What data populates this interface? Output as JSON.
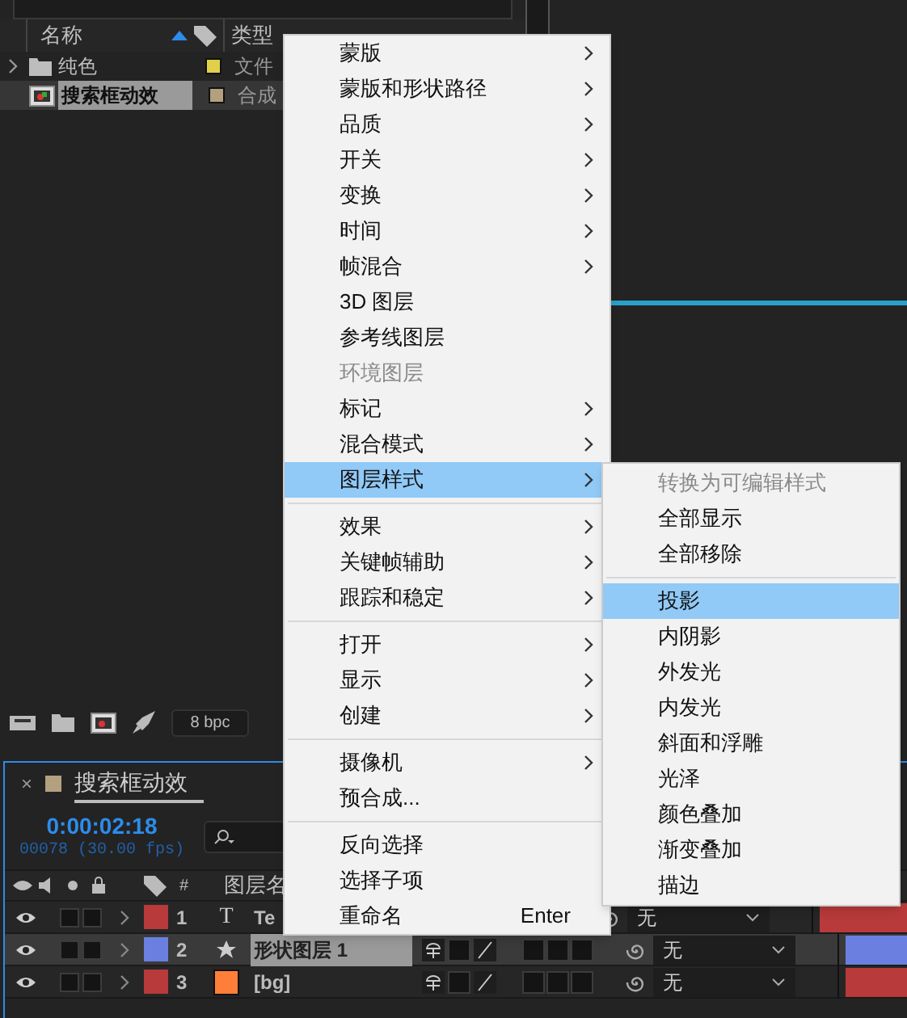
{
  "project": {
    "columns": [
      {
        "label": "名称",
        "sorted": true
      },
      {
        "label": "类型",
        "sorted": false
      }
    ],
    "items": [
      {
        "kind": "folder",
        "name": "纯色",
        "color": "#e0d04a",
        "type": "文件",
        "selected": false
      },
      {
        "kind": "comp",
        "name": "搜索框动效",
        "color": "#b3a07e",
        "type": "合成",
        "selected": true
      }
    ],
    "toolbar": {
      "bpc": "8 bpc"
    }
  },
  "timeline": {
    "close": "×",
    "tab": "搜索框动效",
    "time": "0:00:02:18",
    "frames": "00078 (30.00 fps)",
    "columns": [
      "#",
      "图层名"
    ],
    "layers": [
      {
        "number": "1",
        "kind": "text",
        "type_glyph": "T",
        "name": "Te",
        "color": "#b83a3a",
        "selected": false,
        "mode": "无"
      },
      {
        "number": "2",
        "kind": "shape",
        "name": "形状图层 1",
        "color": "#6b7fe0",
        "selected": true,
        "mode": "无"
      },
      {
        "number": "3",
        "kind": "solid",
        "name": "[bg]",
        "color": "#b83a3a",
        "selected": false,
        "mode": "无"
      }
    ]
  },
  "context_menu": {
    "items": [
      {
        "kind": "item",
        "label": "蒙版",
        "submenu": true,
        "disabled": false,
        "selected": false
      },
      {
        "kind": "item",
        "label": "蒙版和形状路径",
        "submenu": true,
        "disabled": false,
        "selected": false
      },
      {
        "kind": "item",
        "label": "品质",
        "submenu": true,
        "disabled": false,
        "selected": false
      },
      {
        "kind": "item",
        "label": "开关",
        "submenu": true,
        "disabled": false,
        "selected": false
      },
      {
        "kind": "item",
        "label": "变换",
        "submenu": true,
        "disabled": false,
        "selected": false
      },
      {
        "kind": "item",
        "label": "时间",
        "submenu": true,
        "disabled": false,
        "selected": false
      },
      {
        "kind": "item",
        "label": "帧混合",
        "submenu": true,
        "disabled": false,
        "selected": false
      },
      {
        "kind": "item",
        "label": "3D 图层",
        "submenu": false,
        "disabled": false,
        "selected": false
      },
      {
        "kind": "item",
        "label": "参考线图层",
        "submenu": false,
        "disabled": false,
        "selected": false
      },
      {
        "kind": "item",
        "label": "环境图层",
        "submenu": false,
        "disabled": true,
        "selected": false
      },
      {
        "kind": "item",
        "label": "标记",
        "submenu": true,
        "disabled": false,
        "selected": false
      },
      {
        "kind": "item",
        "label": "混合模式",
        "submenu": true,
        "disabled": false,
        "selected": false
      },
      {
        "kind": "item",
        "label": "图层样式",
        "submenu": true,
        "disabled": false,
        "selected": true
      },
      {
        "kind": "separator"
      },
      {
        "kind": "item",
        "label": "效果",
        "submenu": true,
        "disabled": false,
        "selected": false
      },
      {
        "kind": "item",
        "label": "关键帧辅助",
        "submenu": true,
        "disabled": false,
        "selected": false
      },
      {
        "kind": "item",
        "label": "跟踪和稳定",
        "submenu": true,
        "disabled": false,
        "selected": false
      },
      {
        "kind": "separator"
      },
      {
        "kind": "item",
        "label": "打开",
        "submenu": true,
        "disabled": false,
        "selected": false
      },
      {
        "kind": "item",
        "label": "显示",
        "submenu": true,
        "disabled": false,
        "selected": false
      },
      {
        "kind": "item",
        "label": "创建",
        "submenu": true,
        "disabled": false,
        "selected": false
      },
      {
        "kind": "separator"
      },
      {
        "kind": "item",
        "label": "摄像机",
        "submenu": true,
        "disabled": false,
        "selected": false
      },
      {
        "kind": "item",
        "label": "预合成...",
        "submenu": false,
        "disabled": false,
        "selected": false
      },
      {
        "kind": "separator"
      },
      {
        "kind": "item",
        "label": "反向选择",
        "submenu": false,
        "disabled": false,
        "selected": false
      },
      {
        "kind": "item",
        "label": "选择子项",
        "submenu": false,
        "disabled": false,
        "selected": false
      },
      {
        "kind": "item",
        "label": "重命名",
        "shortcut": "Enter",
        "submenu": false,
        "disabled": false,
        "selected": false
      }
    ]
  },
  "submenu": {
    "items": [
      {
        "kind": "item",
        "label": "转换为可编辑样式",
        "disabled": true,
        "selected": false
      },
      {
        "kind": "item",
        "label": "全部显示",
        "disabled": false,
        "selected": false
      },
      {
        "kind": "item",
        "label": "全部移除",
        "disabled": false,
        "selected": false
      },
      {
        "kind": "separator"
      },
      {
        "kind": "item",
        "label": "投影",
        "disabled": false,
        "selected": true
      },
      {
        "kind": "item",
        "label": "内阴影",
        "disabled": false,
        "selected": false
      },
      {
        "kind": "item",
        "label": "外发光",
        "disabled": false,
        "selected": false
      },
      {
        "kind": "item",
        "label": "内发光",
        "disabled": false,
        "selected": false
      },
      {
        "kind": "item",
        "label": "斜面和浮雕",
        "disabled": false,
        "selected": false
      },
      {
        "kind": "item",
        "label": "光泽",
        "disabled": false,
        "selected": false
      },
      {
        "kind": "item",
        "label": "颜色叠加",
        "disabled": false,
        "selected": false
      },
      {
        "kind": "item",
        "label": "渐变叠加",
        "disabled": false,
        "selected": false
      },
      {
        "kind": "item",
        "label": "描边",
        "disabled": false,
        "selected": false
      }
    ]
  }
}
